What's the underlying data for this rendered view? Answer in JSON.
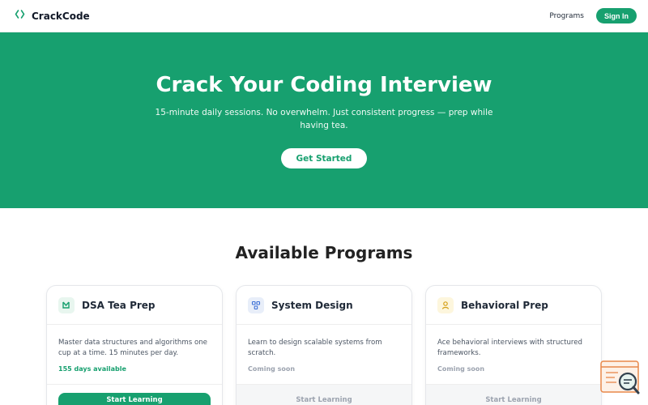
{
  "nav": {
    "brand_icon": "code-brackets-icon",
    "brand": "CrackCode",
    "programs_link": "Programs",
    "signin": "Sign In"
  },
  "hero": {
    "title": "Crack Your Coding Interview",
    "subtitle": "15-minute daily sessions. No overwhelm. Just consistent progress — prep while having tea.",
    "cta": "Get Started"
  },
  "programs": {
    "heading": "Available Programs",
    "cards": [
      {
        "icon": "tea-cup-icon",
        "title": "DSA Tea Prep",
        "description": "Master data structures and algorithms one cup at a time. 15 minutes per day.",
        "availability": "155 days available",
        "button": "Start Learning"
      },
      {
        "icon": "system-diagram-icon",
        "title": "System Design",
        "description": "Learn to design scalable systems from scratch.",
        "availability": "Coming soon",
        "button": "Start Learning"
      },
      {
        "icon": "person-icon",
        "title": "Behavioral Prep",
        "description": "Ace behavioral interviews with structured frameworks.",
        "availability": "Coming soon",
        "button": "Start Learning"
      }
    ]
  },
  "widget": {
    "icon": "document-search-icon"
  },
  "colors": {
    "accent": "#17a06f",
    "muted": "#9ca3af"
  }
}
